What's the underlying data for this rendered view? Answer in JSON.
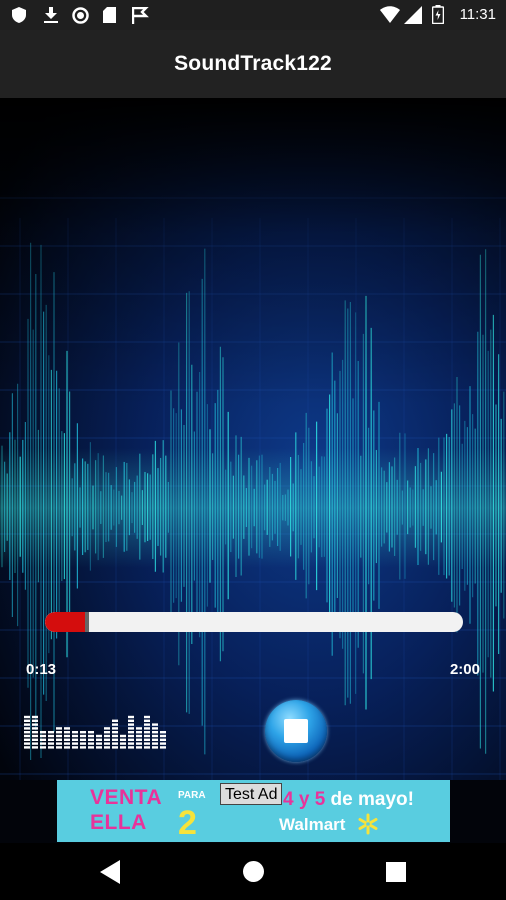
{
  "status_bar": {
    "time": "11:31",
    "left_icons": [
      "shield-icon",
      "download-icon",
      "circle-icon",
      "sd-card-icon",
      "flag-icon"
    ],
    "right_icons": [
      "wifi-icon",
      "signal-icon",
      "battery-icon"
    ]
  },
  "app_bar": {
    "title": "SoundTrack122"
  },
  "player": {
    "current_time": "0:13",
    "total_time": "2:00",
    "progress": 0.1,
    "stop_icon": "stop-icon"
  },
  "equalizer": {
    "levels": [
      9,
      9,
      5,
      5,
      6,
      6,
      5,
      5,
      5,
      4,
      6,
      8,
      4,
      9,
      6,
      9,
      7,
      5
    ]
  },
  "ad": {
    "label": "Test Ad",
    "venta": "VENTA",
    "para": "PARA",
    "ella": "ELLA",
    "two": "2",
    "dates_highlight": "4 y 5",
    "dates_rest": "de mayo!",
    "brand": "Walmart"
  },
  "nav_bar": {
    "icons": [
      "back-icon",
      "home-icon",
      "recents-icon"
    ]
  },
  "colors": {
    "accent_red": "#d40d0d",
    "app_bar": "#222222",
    "wave": "#2ee6e6"
  }
}
